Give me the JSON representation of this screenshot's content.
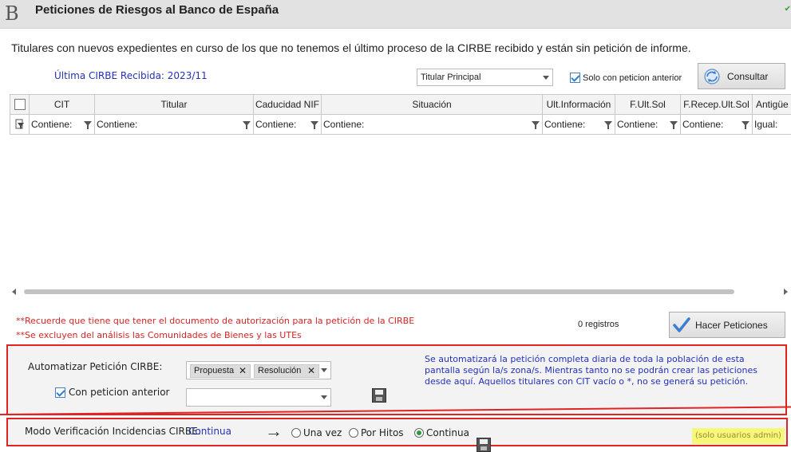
{
  "header": {
    "logo_text": "B",
    "title": "Peticiones de Riesgos al Banco de España",
    "corner_mark": "✔"
  },
  "description": "Titulares con nuevos expedientes en curso de los que no tenemos el último proceso de la CIRBE recibido y están sin petición de informe.",
  "last_cirbe": "Última CIRBE Recibida: 2023/11",
  "toolbar": {
    "titular_select": "Titular Principal",
    "solo_con_peticion_label": "Solo con peticion anterior",
    "solo_con_peticion_checked": true,
    "consultar_label": "Consultar"
  },
  "grid": {
    "columns": [
      {
        "header": "CIT",
        "filter": "Contiene:"
      },
      {
        "header": "Titular",
        "filter": "Contiene:"
      },
      {
        "header": "Caducidad NIF",
        "filter": "Contiene:"
      },
      {
        "header": "Situación",
        "filter": "Contiene:"
      },
      {
        "header": "Ult.Información",
        "filter": "Contiene:"
      },
      {
        "header": "F.Ult.Sol",
        "filter": "Contiene:"
      },
      {
        "header": "F.Recep.Ult.Sol",
        "filter": "Contiene:"
      },
      {
        "header": "Antigüe",
        "filter": "Igual:"
      }
    ]
  },
  "notes": [
    "**Recuerde que tiene que tener el documento de autorización para la petición de la CIRBE",
    "**Se excluyen del análisis las Comunidades de Bienes y las UTEs"
  ],
  "records": "0 registros",
  "hacer_peticiones_label": "Hacer Peticiones",
  "automation": {
    "label": "Automatizar Petición CIRBE:",
    "chips": [
      "Propuesta",
      "Resolución"
    ],
    "con_peticion_label": "Con peticion anterior",
    "con_peticion_checked": true,
    "second_select": "",
    "info": "Se automatizará la petición completa diaria de toda la población de esta pantalla según la/s zona/s. Mientras tanto no se podrán crear las peticiones desde aquí. Aquellos titulares con CIT vacío o *, no se generá su petición."
  },
  "modo": {
    "label": "Modo Verificación Incidencias CIRBE:",
    "value": "Continua",
    "arrow": "→",
    "options": [
      {
        "label": "Una vez",
        "selected": false
      },
      {
        "label": "Por Hitos",
        "selected": false
      },
      {
        "label": "Continua",
        "selected": true
      }
    ],
    "admin_note": "(solo usuarios admin)"
  },
  "colors": {
    "accent_blue": "#2431b6",
    "note_red": "#d32626",
    "frame_red": "#e02424",
    "highlight_yellow": "#f7f77a"
  }
}
